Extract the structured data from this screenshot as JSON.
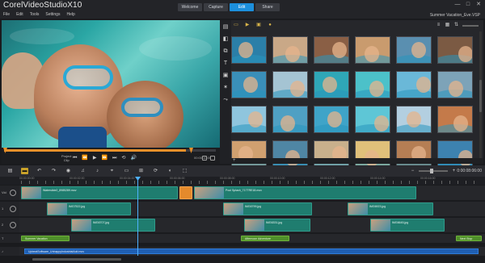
{
  "app": {
    "title_brand": "Corel",
    "title_product": "VideoStudio",
    "title_version": "X10",
    "project_name": "Summer Vacation_Eve.VSP"
  },
  "nav_tabs": [
    {
      "label": "Welcome",
      "active": false
    },
    {
      "label": "Capture",
      "active": false
    },
    {
      "label": "Edit",
      "active": true
    },
    {
      "label": "Share",
      "active": false
    }
  ],
  "window_controls": {
    "minimize": "—",
    "maximize": "□",
    "close": "✕"
  },
  "menu": [
    "File",
    "Edit",
    "Tools",
    "Settings",
    "Help"
  ],
  "preview": {
    "mode_label": "Project",
    "mode_sub": "Clip",
    "timecode": "00:00:10:00",
    "buttons": [
      "⏮",
      "⏪",
      "▶",
      "⏩",
      "⏭",
      "⟲",
      "🔊"
    ],
    "scrub_fraction": 0.86
  },
  "library": {
    "side_icons": [
      "media-icon",
      "instant-project-icon",
      "transition-icon",
      "title-icon",
      "graphic-icon",
      "filter-icon",
      "path-icon"
    ],
    "folder_icons": [
      "add-folder-icon",
      "video-filter-icon",
      "photo-filter-icon",
      "audio-filter-icon"
    ],
    "view_icons": [
      "list-view-icon",
      "thumbnail-view-icon",
      "sort-icon",
      "settings-icon"
    ],
    "add_label": "+",
    "thumbnails": [
      {
        "bg": "#2b7fa8"
      },
      {
        "bg": "#c9a887"
      },
      {
        "bg": "#8a5f45"
      },
      {
        "bg": "#c99b6e"
      },
      {
        "bg": "#5a8fb0"
      },
      {
        "bg": "#7b5a43"
      },
      {
        "bg": "#3a8fb9"
      },
      {
        "bg": "#a5c4d3"
      },
      {
        "bg": "#2fa7b7"
      },
      {
        "bg": "#4cc1c9"
      },
      {
        "bg": "#6ab8d8"
      },
      {
        "bg": "#7da3b8"
      },
      {
        "bg": "#8fc5dd"
      },
      {
        "bg": "#4fa0c3"
      },
      {
        "bg": "#3fa4c8"
      },
      {
        "bg": "#5ec6d6"
      },
      {
        "bg": "#b3cfe0"
      },
      {
        "bg": "#c47a4a"
      },
      {
        "bg": "#d0a070"
      },
      {
        "bg": "#4f86a4"
      },
      {
        "bg": "#c8b08c"
      },
      {
        "bg": "#e0c07a"
      },
      {
        "bg": "#b57e54"
      },
      {
        "bg": "#3d82b0"
      }
    ]
  },
  "timeline": {
    "timecode": "0:00:08:06:00",
    "ruler_labels": [
      "00:00:00:00",
      "00:00:02:00",
      "00:00:04:00",
      "00:00:06:00",
      "00:00:08:00",
      "00:00:10:00",
      "00:00:12:00",
      "00:00:14:00",
      "00:00:16:00"
    ],
    "tracks": [
      {
        "label": "Vid",
        "clips": [
          {
            "name": "Waterslide2_8985289.mov"
          },
          {
            "name": "Pool Splash_717TRE18.mov"
          }
        ]
      },
      {
        "label": "1",
        "clips": [
          {
            "name": "IMG7522.jpg"
          },
          {
            "name": "IMG6799.jpg"
          },
          {
            "name": "IMG6923.jpg"
          }
        ]
      },
      {
        "label": "2",
        "clips": [
          {
            "name": "IMG6707.jpg"
          },
          {
            "name": "IMG6331.jpg"
          },
          {
            "name": "IMG6645.jpg"
          }
        ]
      },
      {
        "label": "T",
        "clips": [
          {
            "name": "Summer Vacation"
          },
          {
            "name": "Afternoon Adventure"
          },
          {
            "name": "Next Stop"
          }
        ]
      },
      {
        "label": "♪",
        "clips": [
          {
            "name": "UpbeatSoftware_UnhappyIndustrialAdd.mov"
          }
        ]
      }
    ]
  },
  "colors": {
    "accent": "#1c8fdc",
    "video_clip": "#1f7d6f",
    "title_clip": "#4f8f2a",
    "audio_clip": "#1f5fb3",
    "transition": "#e48a2c",
    "scrubber": "#e8902a"
  }
}
